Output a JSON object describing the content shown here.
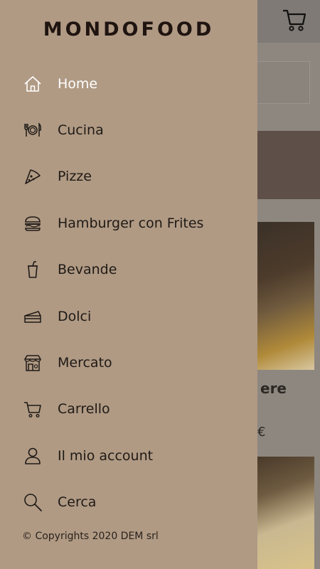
{
  "app": {
    "brand": "MONDOFOOD"
  },
  "menu": [
    {
      "label": "Home",
      "icon": "home-icon"
    },
    {
      "label": "Cucina",
      "icon": "utensils-icon"
    },
    {
      "label": "Pizze",
      "icon": "pizza-slice-icon"
    },
    {
      "label": "Hamburger con Frites",
      "icon": "hamburger-icon"
    },
    {
      "label": "Bevande",
      "icon": "drink-cup-icon"
    },
    {
      "label": "Dolci",
      "icon": "cake-slice-icon"
    },
    {
      "label": "Mercato",
      "icon": "market-icon"
    },
    {
      "label": "Carrello",
      "icon": "cart-icon"
    },
    {
      "label": "Il mio account",
      "icon": "user-icon"
    },
    {
      "label": "Cerca",
      "icon": "search-icon"
    }
  ],
  "footer": {
    "copyright": "© Copyrights 2020 DEM srl"
  },
  "background_page": {
    "card_title_partial": "ere",
    "card_price_partial": "€"
  },
  "colors": {
    "drawer_bg": "#b09a84",
    "active_text": "#ffffff",
    "text": "#1f1a16"
  }
}
